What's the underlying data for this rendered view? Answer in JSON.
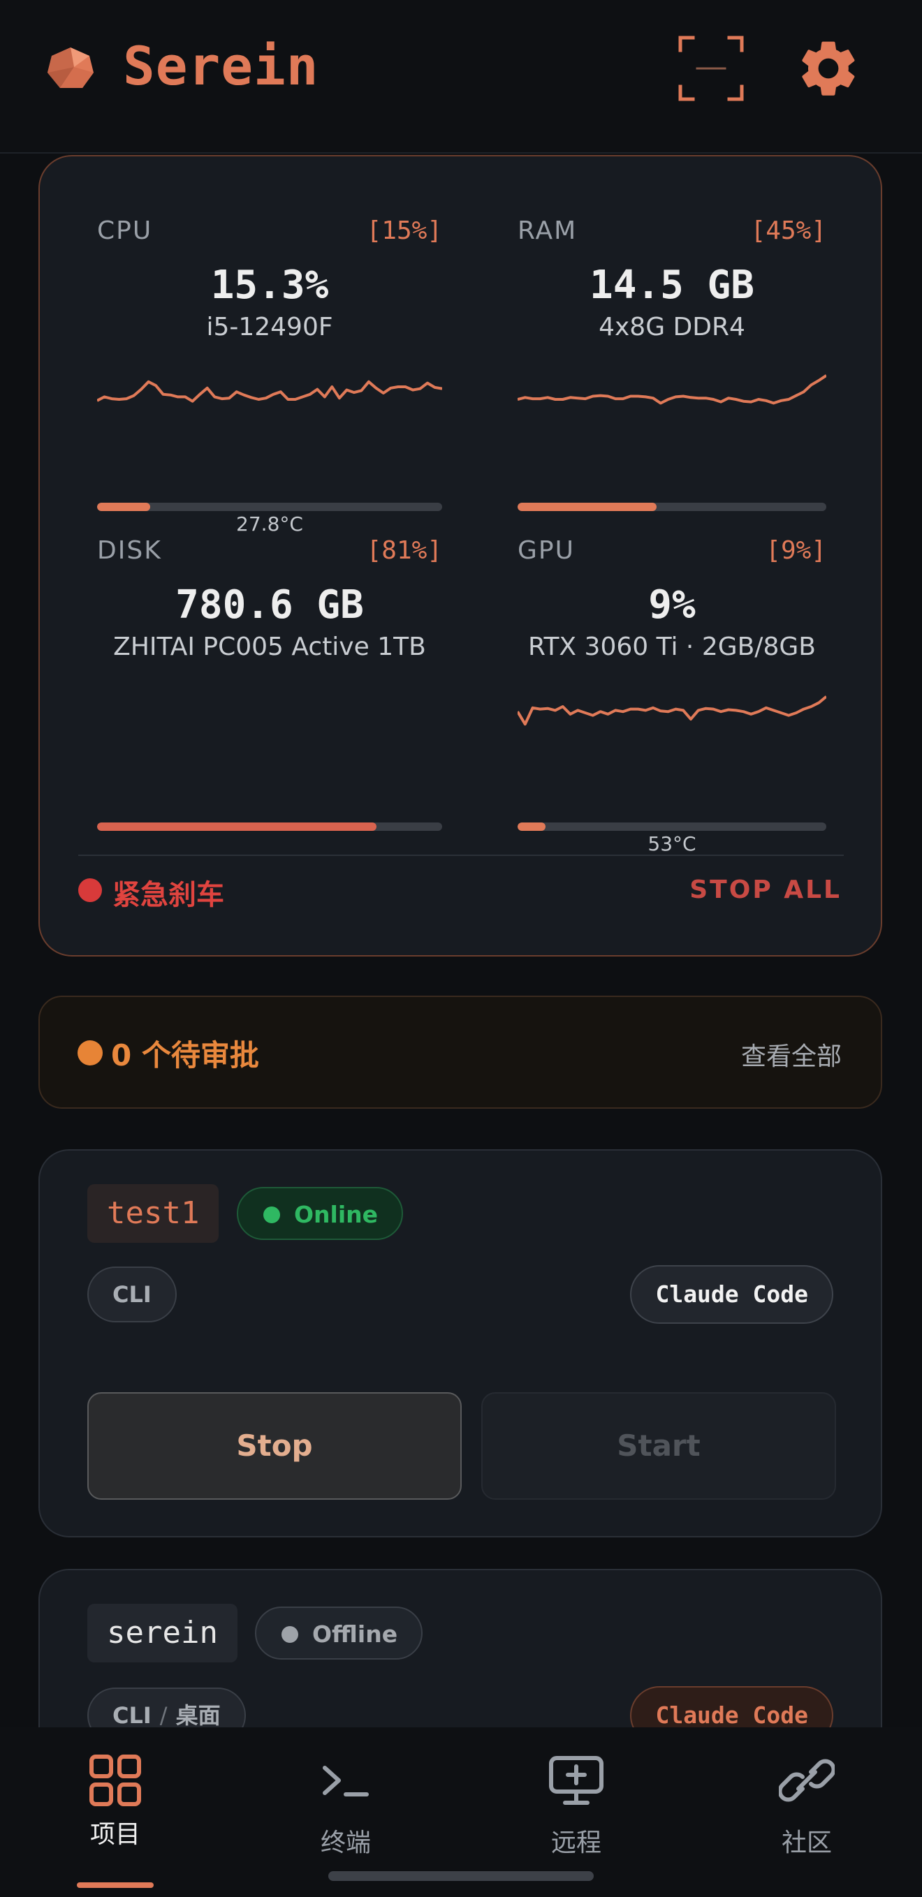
{
  "header": {
    "app_title": "Serein",
    "brand_icon": "gem-logo-icon",
    "scan_icon": "scan-icon",
    "settings_icon": "gear-icon",
    "accent_color": "#e07a58"
  },
  "monitor": {
    "cpu": {
      "label": "CPU",
      "percent_label": "[15%]",
      "value": "15.3%",
      "subtitle": "i5-12490F",
      "usage": 0.153,
      "temperature": "27.8°C",
      "sparkline": [
        38,
        44,
        41,
        40,
        41,
        46,
        56,
        68,
        62,
        48,
        47,
        44,
        44,
        37,
        48,
        58,
        44,
        41,
        42,
        52,
        47,
        43,
        40,
        42,
        48,
        52,
        40,
        40,
        44,
        48,
        56,
        44,
        60,
        42,
        55,
        51,
        54,
        68,
        58,
        50,
        58,
        60,
        60,
        55,
        57,
        66,
        59,
        57
      ]
    },
    "ram": {
      "label": "RAM",
      "percent_label": "[45%]",
      "value": "14.5 GB",
      "subtitle": "4x8G DDR4",
      "usage": 0.45,
      "sparkline": [
        40,
        43,
        41,
        41,
        43,
        40,
        40,
        43,
        42,
        41,
        45,
        46,
        45,
        41,
        41,
        45,
        45,
        44,
        42,
        34,
        40,
        44,
        45,
        43,
        42,
        42,
        40,
        36,
        42,
        40,
        37,
        36,
        40,
        38,
        34,
        38,
        40,
        46,
        52,
        63,
        70,
        78
      ]
    },
    "disk": {
      "label": "DISK",
      "percent_label": "[81%]",
      "value": "780.6 GB",
      "subtitle": "ZHITAI PC005 Active 1TB",
      "usage": 0.81
    },
    "gpu": {
      "label": "GPU",
      "percent_label": "[9%]",
      "value": "9%",
      "subtitle": "RTX 3060 Ti · 2GB/8GB",
      "usage": 0.09,
      "temperature": "53°C",
      "sparkline": [
        52,
        32,
        58,
        56,
        57,
        54,
        60,
        48,
        54,
        50,
        46,
        52,
        48,
        54,
        52,
        56,
        56,
        54,
        58,
        53,
        52,
        56,
        54,
        40,
        54,
        57,
        56,
        52,
        55,
        54,
        52,
        48,
        52,
        58,
        54,
        50,
        46,
        50,
        56,
        60,
        66,
        76
      ]
    },
    "brake_label": "紧急刹车",
    "stop_all_label": "STOP ALL"
  },
  "approvals": {
    "label": "0 个待审批",
    "view_all": "查看全部"
  },
  "projects": [
    {
      "name": "test1",
      "status": "Online",
      "mode": "CLI",
      "agent": "Claude Code",
      "stop_label": "Stop",
      "start_label": "Start"
    },
    {
      "name": "serein",
      "status": "Offline",
      "mode": "CLI",
      "mode_extra": "桌面",
      "mode_separator": "/",
      "agent": "Claude Code"
    }
  ],
  "nav": {
    "items": [
      {
        "label": "项目",
        "icon": "grid-icon",
        "active": true
      },
      {
        "label": "终端",
        "icon": "terminal-icon"
      },
      {
        "label": "远程",
        "icon": "remote-desktop-icon"
      },
      {
        "label": "社区",
        "icon": "link-icon"
      }
    ]
  }
}
